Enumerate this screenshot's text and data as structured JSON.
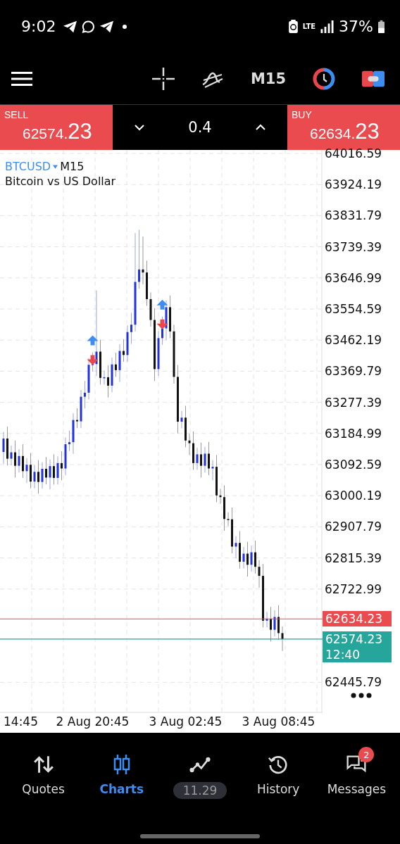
{
  "status_bar": {
    "time": "9:02",
    "network": "LTE",
    "battery": "37%"
  },
  "toolbar": {
    "timeframe": "M15"
  },
  "trade_bar": {
    "sell": {
      "label": "SELL",
      "price_main": "62574.",
      "price_big": "23"
    },
    "volume": "0.4",
    "buy": {
      "label": "BUY",
      "price_main": "62634.",
      "price_big": "23"
    }
  },
  "chart": {
    "symbol": "BTCUSD",
    "timeframe": "M15",
    "description": "Bitcoin vs US Dollar",
    "chart_data": {
      "type": "candlestick",
      "categories": [
        null,
        null,
        null,
        null,
        null,
        null,
        null,
        null,
        null,
        null,
        null,
        null,
        null,
        null,
        null,
        null,
        null,
        null,
        null,
        null,
        null,
        null,
        null,
        "2 Aug 20:45",
        null,
        null,
        null,
        null,
        null,
        null,
        null,
        null,
        null,
        null,
        null,
        null,
        null,
        null,
        null,
        null,
        null,
        null,
        null,
        null,
        null,
        null,
        null,
        "3 Aug 02:45",
        null,
        null,
        null,
        null,
        null,
        null,
        null,
        null,
        null,
        null,
        null,
        null,
        null,
        null,
        null,
        null,
        null,
        null,
        null,
        null,
        null,
        null,
        null,
        "3 Aug 08:45",
        null
      ],
      "ohlc": [
        [
          63130,
          63190,
          63095,
          63170
        ],
        [
          63170,
          63205,
          63090,
          63110
        ],
        [
          63110,
          63149,
          63090,
          63129
        ],
        [
          63129,
          63164,
          63054,
          63089
        ],
        [
          63089,
          63138,
          63069,
          63118
        ],
        [
          63118,
          63153,
          63053,
          63073
        ],
        [
          63073,
          63112,
          63038,
          63092
        ],
        [
          63092,
          63127,
          63022,
          63042
        ],
        [
          63042,
          63091,
          63022,
          63071
        ],
        [
          63071,
          63106,
          63006,
          63041
        ],
        [
          63041,
          63100,
          63021,
          63080
        ],
        [
          63080,
          63115,
          63034,
          63054
        ],
        [
          63054,
          63108,
          63019,
          63088
        ],
        [
          63088,
          63123,
          63033,
          63053
        ],
        [
          63053,
          63117,
          63033,
          63097
        ],
        [
          63097,
          63132,
          63046,
          63081
        ],
        [
          63081,
          63173,
          63061,
          63153
        ],
        [
          63153,
          63194,
          63133,
          63159
        ],
        [
          63159,
          63245,
          63124,
          63225
        ],
        [
          63225,
          63260,
          63201,
          63221
        ],
        [
          63221,
          63314,
          63201,
          63294
        ],
        [
          63294,
          63341,
          63259,
          63306
        ],
        [
          63306,
          63409,
          63286,
          63389
        ],
        [
          63389,
          63426,
          63369,
          63391
        ],
        [
          63391,
          63610,
          63356,
          63428
        ],
        [
          63428,
          63463,
          63330,
          63350
        ],
        [
          63350,
          63372,
          63330,
          63352
        ],
        [
          63352,
          63387,
          63292,
          63327
        ],
        [
          63327,
          63410,
          63307,
          63390
        ],
        [
          63390,
          63425,
          63353,
          63373
        ],
        [
          63373,
          63450,
          63338,
          63430
        ],
        [
          63430,
          63465,
          63398,
          63418
        ],
        [
          63418,
          63506,
          63398,
          63486
        ],
        [
          63486,
          63543,
          63451,
          63508
        ],
        [
          63508,
          63780,
          63488,
          63635
        ],
        [
          63635,
          63790,
          63615,
          63672
        ],
        [
          63672,
          63770,
          63628,
          63663
        ],
        [
          63663,
          63698,
          63564,
          63584
        ],
        [
          63584,
          63604,
          63502,
          63522
        ],
        [
          63522,
          63557,
          63341,
          63376
        ],
        [
          63376,
          63488,
          63356,
          63468
        ],
        [
          63468,
          63532,
          63448,
          63497
        ],
        [
          63497,
          63580,
          63462,
          63560
        ],
        [
          63560,
          63595,
          63468,
          63488
        ],
        [
          63488,
          63508,
          63333,
          63353
        ],
        [
          63353,
          63388,
          63185,
          63220
        ],
        [
          63220,
          63252,
          63200,
          63232
        ],
        [
          63232,
          63267,
          63144,
          63164
        ],
        [
          63164,
          63184,
          63121,
          63156
        ],
        [
          63156,
          63191,
          63077,
          63097
        ],
        [
          63097,
          63143,
          63077,
          63123
        ],
        [
          63123,
          63158,
          63054,
          63089
        ],
        [
          63089,
          63145,
          63069,
          63125
        ],
        [
          63125,
          63160,
          63061,
          63081
        ],
        [
          63081,
          63106,
          63046,
          63086
        ],
        [
          63086,
          63121,
          62981,
          63001
        ],
        [
          63001,
          63021,
          62976,
          62996
        ],
        [
          62996,
          63031,
          62896,
          62931
        ],
        [
          62931,
          62951,
          62910,
          62930
        ],
        [
          62930,
          62965,
          62829,
          62849
        ],
        [
          62849,
          62880,
          62814,
          62860
        ],
        [
          62860,
          62895,
          62784,
          62804
        ],
        [
          62804,
          62848,
          62784,
          62828
        ],
        [
          62828,
          62863,
          62760,
          62795
        ],
        [
          62795,
          62852,
          62775,
          62832
        ],
        [
          62832,
          62867,
          62769,
          62789
        ],
        [
          62789,
          62809,
          62727,
          62762
        ],
        [
          62762,
          62797,
          62609,
          62629
        ],
        [
          62629,
          62655,
          62609,
          62635
        ],
        [
          62635,
          62670,
          62567,
          62602
        ],
        [
          62602,
          62660,
          62582,
          62640
        ],
        [
          62640,
          62675,
          62572,
          62592
        ],
        [
          62592,
          62612,
          62539,
          62574.23
        ]
      ],
      "ylim": [
        62354.6,
        64027.0
      ],
      "grid": true,
      "yticks": [
        64016.59,
        63924.19,
        63831.79,
        63739.39,
        63646.99,
        63554.59,
        63462.19,
        63369.79,
        63277.39,
        63184.99,
        63092.59,
        63000.19,
        62907.79,
        62815.39,
        62722.99,
        62445.79
      ],
      "ref_lines": [
        {
          "axis": "y",
          "value": 62634.23,
          "color": "#e94b4f"
        },
        {
          "axis": "y",
          "value": 62574.23,
          "color": "#26a69a"
        }
      ]
    },
    "cut_time_label": "14:45",
    "ask_tag": "62634.23",
    "bid_tag": {
      "price": "62574.23",
      "countdown": "12:40"
    }
  },
  "bottom_nav": [
    {
      "kind": "quotes",
      "label": "Quotes",
      "selected": false
    },
    {
      "kind": "charts",
      "label": "Charts",
      "selected": true
    },
    {
      "kind": "trade",
      "value": "11.29",
      "selected": false
    },
    {
      "kind": "history",
      "label": "History",
      "selected": false
    },
    {
      "kind": "messages",
      "label": "Messages",
      "badge": "2",
      "selected": false
    }
  ]
}
